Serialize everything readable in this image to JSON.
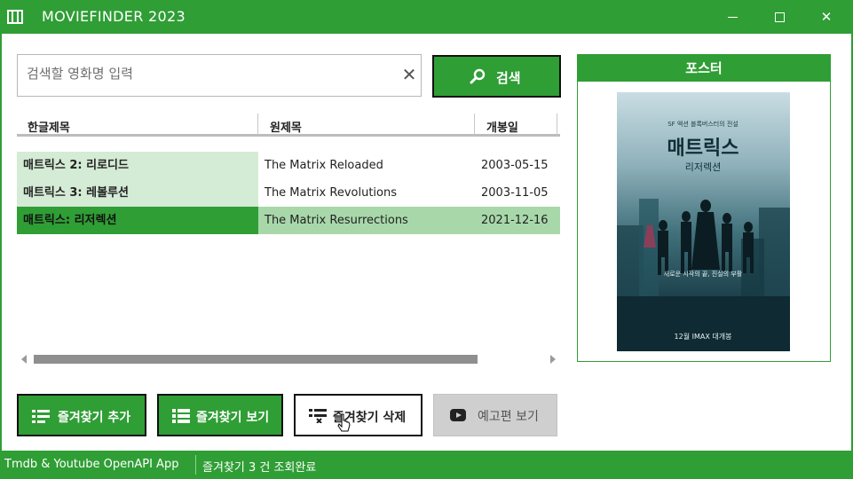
{
  "window": {
    "title": "MOVIEFINDER 2023",
    "accent_color": "#2f9e35"
  },
  "search": {
    "placeholder": "검색할 영화명 입력",
    "value": "",
    "clear_icon": "close-icon",
    "button_label": "검색",
    "button_icon": "search-icon"
  },
  "table": {
    "columns": [
      "한글제목",
      "원제목",
      "개봉일"
    ],
    "rows": [
      {
        "korean_title": "매트릭스 2: 리로디드",
        "original_title": "The Matrix Reloaded",
        "release_date": "2003-05-15",
        "selected": false
      },
      {
        "korean_title": "매트릭스 3: 레볼루션",
        "original_title": "The Matrix Revolutions",
        "release_date": "2003-11-05",
        "selected": false
      },
      {
        "korean_title": "매트릭스: 리저렉션",
        "original_title": "The Matrix Resurrections",
        "release_date": "2021-12-16",
        "selected": true
      }
    ]
  },
  "poster": {
    "header": "포스터",
    "top_text": "SF 액션 블록버스터의 전설",
    "title": "매트릭스",
    "subtitle": "리저렉션",
    "tagline": "새로운 시작의 끝, 진실의 부활",
    "release_text": "12월 IMAX 대개봉"
  },
  "buttons": {
    "add_favorite": "즐겨찾기 추가",
    "view_favorites": "즐겨찾기 보기",
    "delete_favorite": "즐겨찾기 삭제",
    "view_trailer": "예고편 보기"
  },
  "status": {
    "left": "Tmdb & Youtube OpenAPI App",
    "right": "즐겨찾기 3 건 조회완료"
  }
}
